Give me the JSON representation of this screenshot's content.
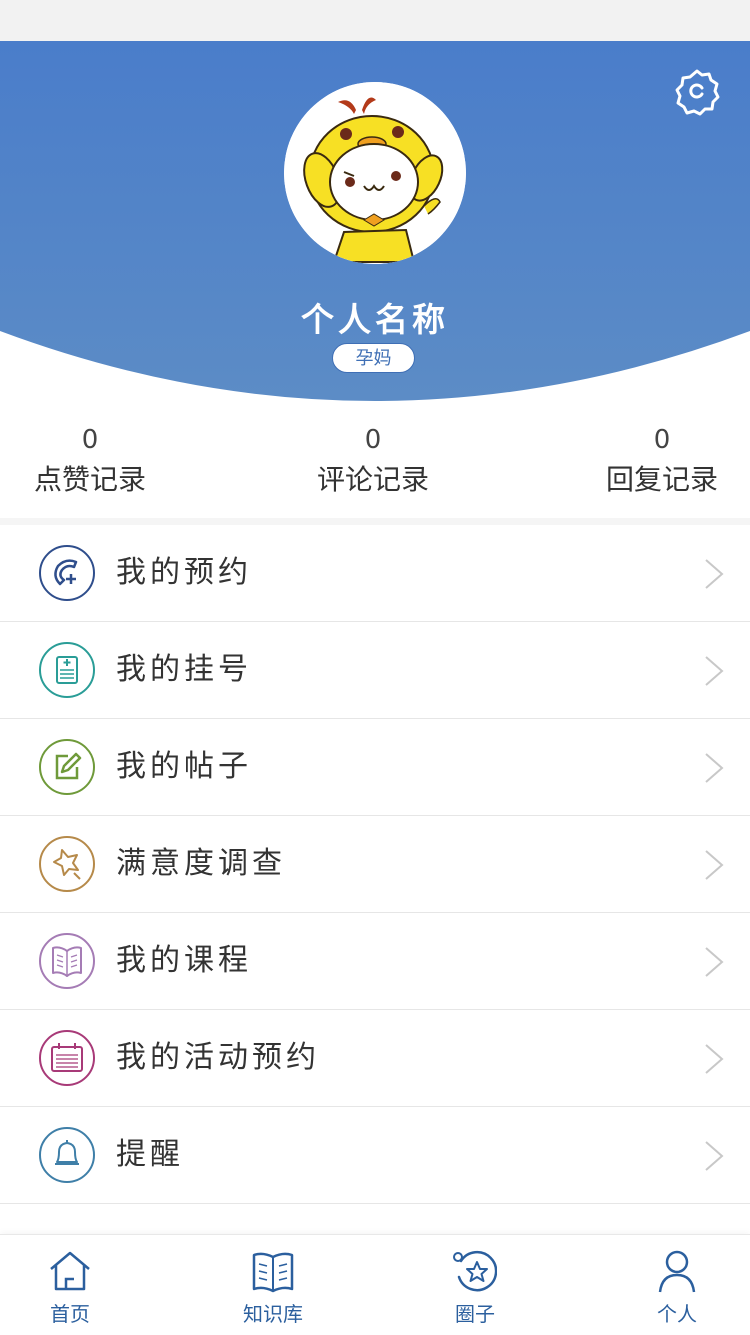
{
  "profile": {
    "name": "个人名称",
    "role": "孕妈"
  },
  "stats": [
    {
      "count": "0",
      "label": "点赞记录"
    },
    {
      "count": "0",
      "label": "评论记录"
    },
    {
      "count": "0",
      "label": "回复记录"
    }
  ],
  "menu": [
    {
      "label": "我的预约",
      "icon": "phone-plus-icon",
      "color": "#2f4e8c"
    },
    {
      "label": "我的挂号",
      "icon": "medical-record-icon",
      "color": "#2a9d97"
    },
    {
      "label": "我的帖子",
      "icon": "edit-icon",
      "color": "#6f9a3a"
    },
    {
      "label": "满意度调查",
      "icon": "star-survey-icon",
      "color": "#b68a4a"
    },
    {
      "label": "我的课程",
      "icon": "book-icon",
      "color": "#a57cb5"
    },
    {
      "label": "我的活动预约",
      "icon": "calendar-icon",
      "color": "#a83a78"
    },
    {
      "label": "提醒",
      "icon": "bell-icon",
      "color": "#3f7fa8"
    }
  ],
  "tabs": [
    {
      "label": "首页",
      "icon": "home-icon"
    },
    {
      "label": "知识库",
      "icon": "book-icon"
    },
    {
      "label": "圈子",
      "icon": "circle-star-icon"
    },
    {
      "label": "个人",
      "icon": "person-icon"
    }
  ],
  "colors": {
    "header_top": "#4a7ec9",
    "header_bottom": "#5b8bc8",
    "tab_accent": "#2b5f9e"
  }
}
